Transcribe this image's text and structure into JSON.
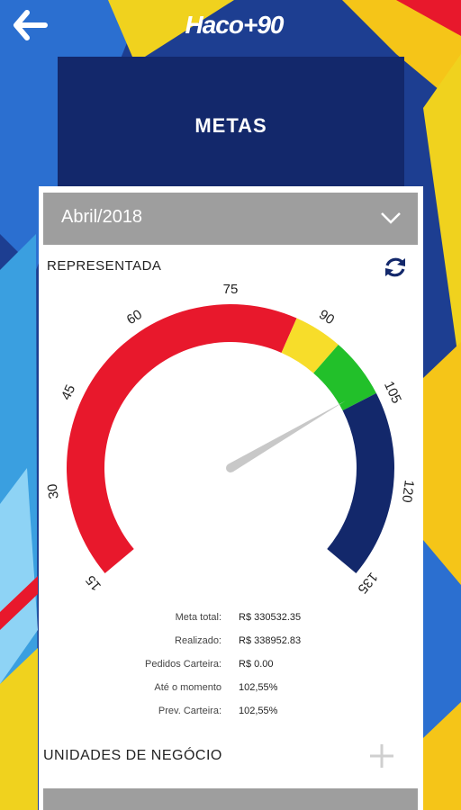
{
  "app": {
    "logo_text": "Haco+90"
  },
  "header": {
    "title": "METAS"
  },
  "month_selector": {
    "value": "Abril/2018",
    "icon": "chevron-down-icon"
  },
  "section": {
    "title": "REPRESENTADA",
    "refresh_icon": "refresh-icon"
  },
  "gauge": {
    "ticks": [
      "15",
      "30",
      "45",
      "60",
      "75",
      "90",
      "105",
      "120",
      "135"
    ],
    "needle_value": 102.55,
    "colors": {
      "red": "#e8182c",
      "yellow": "#f7dd2a",
      "green": "#22c02a",
      "blue": "#13286b"
    }
  },
  "stats": [
    {
      "label": "Meta total:",
      "value": "R$ 330532.35"
    },
    {
      "label": "Realizado:",
      "value": "R$ 338952.83"
    },
    {
      "label": "Pedidos Carteira:",
      "value": "R$ 0.00"
    },
    {
      "label": "Até o momento",
      "value": "102,55%"
    },
    {
      "label": "Prev. Carteira:",
      "value": "102,55%"
    }
  ],
  "business_units": {
    "title": "UNIDADES DE NEGÓCIO",
    "add_icon": "plus-icon"
  }
}
